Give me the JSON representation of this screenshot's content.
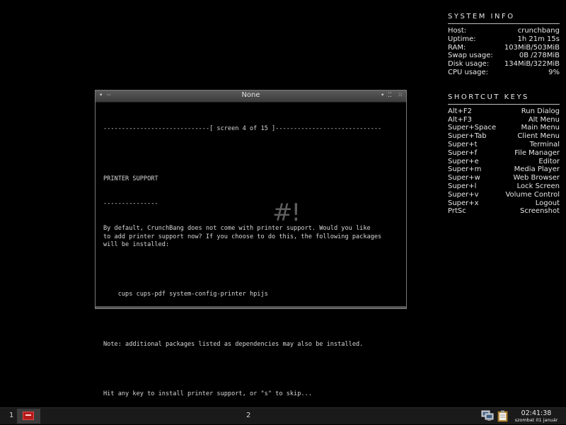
{
  "sysinfo": {
    "heading": "SYSTEM INFO",
    "rows": [
      {
        "label": "Host:",
        "value": "crunchbang"
      },
      {
        "label": "Uptime:",
        "value": "1h 21m 15s"
      },
      {
        "label": "RAM:",
        "value": "103MiB/503MiB"
      },
      {
        "label": "Swap usage:",
        "value": "0B  /278MiB"
      },
      {
        "label": "Disk usage:",
        "value": "134MiB/322MiB"
      },
      {
        "label": "CPU usage:",
        "value": "9%"
      }
    ]
  },
  "shortcuts": {
    "heading": "SHORTCUT KEYS",
    "rows": [
      {
        "key": "Alt+F2",
        "action": "Run Dialog"
      },
      {
        "key": "Alt+F3",
        "action": "Alt Menu"
      },
      {
        "key": "Super+Space",
        "action": "Main Menu"
      },
      {
        "key": "Super+Tab",
        "action": "Client Menu"
      },
      {
        "key": "Super+t",
        "action": "Terminal"
      },
      {
        "key": "Super+f",
        "action": "File Manager"
      },
      {
        "key": "Super+e",
        "action": "Editor"
      },
      {
        "key": "Super+m",
        "action": "Media Player"
      },
      {
        "key": "Super+w",
        "action": "Web Browser"
      },
      {
        "key": "Super+l",
        "action": "Lock Screen"
      },
      {
        "key": "Super+v",
        "action": "Volume Control"
      },
      {
        "key": "Super+x",
        "action": "Logout"
      },
      {
        "key": "PrtSc",
        "action": "Screenshot"
      }
    ]
  },
  "window": {
    "title": "None",
    "btn_menu": "•",
    "btn_shade": "··",
    "btn_iconify": "•",
    "btn_maximize": "⁚⁚",
    "btn_close": "⁙"
  },
  "terminal": {
    "line_screen": "-----------------------------[ screen 4 of 15 ]-----------------------------",
    "heading": "PRINTER SUPPORT",
    "heading_rule": "---------------",
    "para1": "By default, CrunchBang does not come with printer support. Would you like\nto add printer support now? If you choose to do this, the following packages\nwill be installed:",
    "packages": "    cups cups-pdf system-config-printer hpijs",
    "note": "Note: additional packages listed as dependencies may also be installed.",
    "prompt": "Hit any key to install printer support, or \"s\" to skip..."
  },
  "logo": "#!",
  "taskbar": {
    "workspace1": "1",
    "workspace2": "2",
    "clock_time": "02:41:38",
    "clock_date": "szombat 01 január"
  },
  "colors": {
    "background": "#000000",
    "task_icon": "#b51a1a",
    "panel_text": "#e6e6e6"
  },
  "icons": {
    "task": "terminal-icon",
    "tray1": "network-icon",
    "tray2": "clipboard-icon"
  }
}
